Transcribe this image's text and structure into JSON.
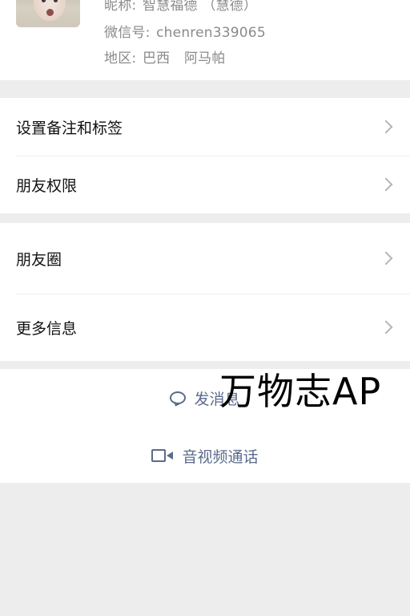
{
  "profile": {
    "nickname_key": "昵称:",
    "nickname_value": "智慧福德 （慧德）",
    "wechat_key": "微信号:",
    "wechat_value": "chenren339065",
    "region_key": "地区:",
    "region_value_country": "巴西",
    "region_value_city": "阿马帕"
  },
  "menu_group_1": [
    {
      "label": "设置备注和标签"
    },
    {
      "label": "朋友权限"
    }
  ],
  "menu_group_2": [
    {
      "label": "朋友圈"
    },
    {
      "label": "更多信息"
    }
  ],
  "actions": {
    "message_label": "发消息",
    "video_label": "音视频通话"
  },
  "watermark": {
    "text": "万物志AP"
  },
  "icons": {
    "message": "message-bubble-icon",
    "video": "video-camera-icon",
    "chevron": "chevron-right-icon"
  },
  "colors": {
    "background": "#ededed",
    "card": "#ffffff",
    "secondary_text": "#8a8a8a",
    "action_text": "#5b6b8c"
  }
}
